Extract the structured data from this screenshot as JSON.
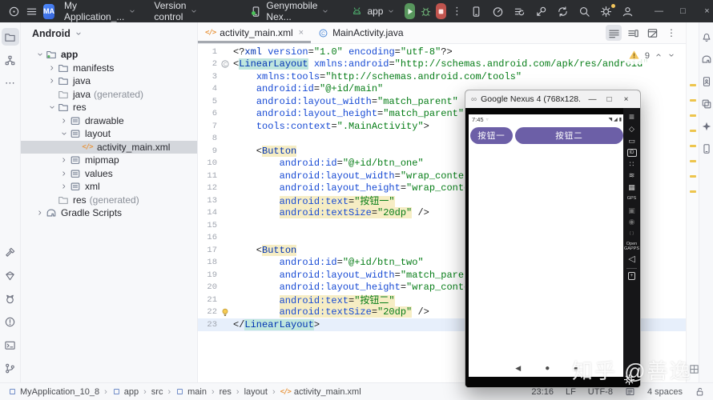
{
  "titlebar": {
    "project_badge": "MA",
    "project_name": "My Application_...",
    "vcs": "Version control",
    "device": "Genymobile Nex...",
    "run_config": "app",
    "win": [
      "—",
      "□",
      "×"
    ],
    "tool_icons": [
      {
        "name": "device-manager-icon",
        "icon": "devphone"
      },
      {
        "name": "profiler-icon",
        "icon": "speed"
      },
      {
        "name": "build-menu-icon",
        "icon": "buildlist"
      },
      {
        "name": "attach-debugger-icon",
        "icon": "attach"
      },
      {
        "name": "sync-project-icon",
        "icon": "sync"
      },
      {
        "name": "search-everywhere-icon",
        "icon": "search"
      },
      {
        "name": "settings-icon",
        "icon": "gear",
        "dot": true
      },
      {
        "name": "account-icon",
        "icon": "user"
      }
    ]
  },
  "tabs": [
    {
      "label": "activity_main.xml",
      "icon": "codetag",
      "active": true,
      "closable": true,
      "close_glyph": "×"
    },
    {
      "label": "MainActivity.java",
      "icon": "classc",
      "active": false
    }
  ],
  "project_panel": {
    "header": "Android",
    "tree": [
      {
        "label": "app",
        "icon": "folderapp",
        "chev": "open",
        "indent": 1,
        "bold": true
      },
      {
        "label": "manifests",
        "icon": "folder",
        "chev": "closed",
        "indent": 2
      },
      {
        "label": "java",
        "icon": "folder",
        "chev": "closed",
        "indent": 2
      },
      {
        "label": "java",
        "suffix": "(generated)",
        "icon": "foldergen",
        "indent": 2
      },
      {
        "label": "res",
        "icon": "folderres",
        "chev": "open",
        "indent": 2
      },
      {
        "label": "drawable",
        "icon": "resdir",
        "chev": "closed",
        "indent": 3
      },
      {
        "label": "layout",
        "icon": "resdir",
        "chev": "open",
        "indent": 3
      },
      {
        "label": "activity_main.xml",
        "icon": "codetag",
        "indent": 4,
        "selected": true
      },
      {
        "label": "mipmap",
        "icon": "resdir",
        "chev": "closed",
        "indent": 3
      },
      {
        "label": "values",
        "icon": "resdir",
        "chev": "closed",
        "indent": 3
      },
      {
        "label": "xml",
        "icon": "resdir",
        "chev": "closed",
        "indent": 3
      },
      {
        "label": "res",
        "suffix": "(generated)",
        "icon": "foldergen",
        "indent": 2
      },
      {
        "label": "Gradle Scripts",
        "icon": "elephant",
        "chev": "closed",
        "indent": 1
      }
    ]
  },
  "left_stripe": {
    "top": [
      {
        "name": "project-tool-icon",
        "icon": "folder",
        "sel": true
      },
      {
        "name": "structure-tool-icon",
        "icon": "structure"
      },
      {
        "name": "more-tools-icon",
        "glyph": "⋯"
      }
    ],
    "bottom": [
      {
        "name": "build-tool-icon",
        "icon": "hammer"
      },
      {
        "name": "app-quality-insights-icon",
        "icon": "gem"
      },
      {
        "name": "logcat-icon",
        "icon": "cat"
      },
      {
        "name": "problems-icon",
        "icon": "warnc"
      },
      {
        "name": "terminal-icon",
        "icon": "term"
      },
      {
        "name": "version-control-icon",
        "icon": "branch"
      }
    ]
  },
  "right_stripe": [
    {
      "name": "notifications-icon",
      "icon": "bell"
    },
    {
      "name": "gradle-icon",
      "icon": "elephant"
    },
    {
      "name": "device-manager-icon",
      "icon": "phoneuser"
    },
    {
      "name": "device-explorer-icon",
      "icon": "layers"
    },
    {
      "name": "gemini-icon",
      "icon": "sparkle"
    },
    {
      "name": "running-devices-icon",
      "icon": "phone"
    }
  ],
  "editor": {
    "warning_count": "9",
    "stripe_marks": [
      77,
      96,
      115,
      134,
      153,
      172,
      191,
      210
    ],
    "lines": [
      {
        "n": "1",
        "s": [
          [
            "p",
            "<?"
          ],
          [
            "t",
            "xml"
          ],
          [
            "p",
            " "
          ],
          [
            "a",
            "version"
          ],
          [
            "p",
            "="
          ],
          [
            "s",
            "\"1.0\""
          ],
          [
            "p",
            " "
          ],
          [
            "a",
            "encoding"
          ],
          [
            "p",
            "="
          ],
          [
            "s",
            "\"utf-8\""
          ],
          [
            "p",
            "?>"
          ]
        ]
      },
      {
        "n": "2",
        "g": "classg",
        "s": [
          [
            "p",
            "<"
          ],
          [
            "tm",
            "LinearLayout"
          ],
          [
            "p",
            " "
          ],
          [
            "a",
            "xmlns:android"
          ],
          [
            "p",
            "="
          ],
          [
            "s",
            "\"http://schemas.android.com/apk/res/android\""
          ]
        ]
      },
      {
        "n": "3",
        "s": [
          [
            "p",
            "    "
          ],
          [
            "a",
            "xmlns:tools"
          ],
          [
            "p",
            "="
          ],
          [
            "s",
            "\"http://schemas.android.com/tools\""
          ]
        ]
      },
      {
        "n": "4",
        "s": [
          [
            "p",
            "    "
          ],
          [
            "a",
            "android:id"
          ],
          [
            "p",
            "="
          ],
          [
            "s",
            "\"@+id/main\""
          ]
        ]
      },
      {
        "n": "5",
        "s": [
          [
            "p",
            "    "
          ],
          [
            "a",
            "android:layout_width"
          ],
          [
            "p",
            "="
          ],
          [
            "s",
            "\"match_parent\""
          ]
        ]
      },
      {
        "n": "6",
        "s": [
          [
            "p",
            "    "
          ],
          [
            "a",
            "android:layout_height"
          ],
          [
            "p",
            "="
          ],
          [
            "s",
            "\"match_parent\""
          ]
        ]
      },
      {
        "n": "7",
        "s": [
          [
            "p",
            "    "
          ],
          [
            "a",
            "tools:context"
          ],
          [
            "p",
            "="
          ],
          [
            "s",
            "\".MainActivity\""
          ],
          [
            "p",
            ">"
          ]
        ]
      },
      {
        "n": "8",
        "s": []
      },
      {
        "n": "9",
        "s": [
          [
            "p",
            "    <"
          ],
          [
            "wt",
            "Button"
          ]
        ]
      },
      {
        "n": "10",
        "s": [
          [
            "p",
            "        "
          ],
          [
            "a",
            "android:id"
          ],
          [
            "p",
            "="
          ],
          [
            "s",
            "\"@+id/btn_one\""
          ]
        ]
      },
      {
        "n": "11",
        "s": [
          [
            "p",
            "        "
          ],
          [
            "a",
            "android:layout_width"
          ],
          [
            "p",
            "="
          ],
          [
            "s",
            "\"wrap_content\""
          ]
        ]
      },
      {
        "n": "12",
        "s": [
          [
            "p",
            "        "
          ],
          [
            "a",
            "android:layout_height"
          ],
          [
            "p",
            "="
          ],
          [
            "s",
            "\"wrap_content\""
          ]
        ]
      },
      {
        "n": "13",
        "s": [
          [
            "p",
            "        "
          ],
          [
            "wa",
            "android:text"
          ],
          [
            "wp",
            "="
          ],
          [
            "ws",
            "\"按钮一\""
          ]
        ]
      },
      {
        "n": "14",
        "s": [
          [
            "p",
            "        "
          ],
          [
            "wa",
            "android:textSize"
          ],
          [
            "wp",
            "="
          ],
          [
            "ws",
            "\"20dp\""
          ],
          [
            "p",
            " />"
          ]
        ]
      },
      {
        "n": "15",
        "s": []
      },
      {
        "n": "16",
        "s": []
      },
      {
        "n": "17",
        "s": [
          [
            "p",
            "    <"
          ],
          [
            "wt",
            "Button"
          ]
        ]
      },
      {
        "n": "18",
        "s": [
          [
            "p",
            "        "
          ],
          [
            "a",
            "android:id"
          ],
          [
            "p",
            "="
          ],
          [
            "s",
            "\"@+id/btn_two\""
          ]
        ]
      },
      {
        "n": "19",
        "s": [
          [
            "p",
            "        "
          ],
          [
            "a",
            "android:layout_width"
          ],
          [
            "p",
            "="
          ],
          [
            "s",
            "\"match_parent\""
          ]
        ]
      },
      {
        "n": "20",
        "s": [
          [
            "p",
            "        "
          ],
          [
            "a",
            "android:layout_height"
          ],
          [
            "p",
            "="
          ],
          [
            "s",
            "\"wrap_content\""
          ]
        ]
      },
      {
        "n": "21",
        "s": [
          [
            "p",
            "        "
          ],
          [
            "wa",
            "android:text"
          ],
          [
            "wp",
            "="
          ],
          [
            "ws",
            "\"按钮二\""
          ]
        ]
      },
      {
        "n": "22",
        "g": "bulb",
        "s": [
          [
            "p",
            "        "
          ],
          [
            "wa",
            "android:textSize"
          ],
          [
            "wp",
            "="
          ],
          [
            "ws",
            "\"20dp\""
          ],
          [
            "p",
            " />"
          ]
        ]
      },
      {
        "n": "23",
        "caret": true,
        "s": [
          [
            "p",
            "</"
          ],
          [
            "tm",
            "LinearLayout"
          ],
          [
            "p",
            ">"
          ]
        ]
      }
    ]
  },
  "statusbar": {
    "breadcrumbs": [
      {
        "label": "MyApplication_10_8",
        "icon": "module"
      },
      {
        "label": "app",
        "icon": "module"
      },
      {
        "label": "src"
      },
      {
        "label": "main",
        "icon": "module"
      },
      {
        "label": "res"
      },
      {
        "label": "layout"
      },
      {
        "label": "activity_main.xml",
        "icon": "codetag"
      }
    ],
    "sep": "›",
    "right": [
      {
        "t": "23:16",
        "name": "caret-position"
      },
      {
        "t": "LF",
        "name": "line-ending"
      },
      {
        "t": "UTF-8",
        "name": "encoding"
      },
      {
        "icon": "indents",
        "name": "indent-config-icon"
      },
      {
        "t": "4 spaces",
        "name": "indent-size"
      },
      {
        "icon": "lockopen",
        "name": "write-access-icon"
      }
    ]
  },
  "emulator": {
    "title": "Google Nexus 4 (768x128...",
    "logo_glyph": "∞",
    "win": [
      "—",
      "□",
      "×"
    ],
    "time": "7:45",
    "status_dim": "▿",
    "status_icons": [
      "◥",
      "◢",
      "▮"
    ],
    "button_color": "#6c5fa7",
    "app_buttons": [
      "按钮一",
      "按钮二"
    ],
    "nav": [
      "◀",
      "●",
      "■"
    ],
    "toolbar": [
      {
        "name": "menu-icon",
        "g": "≡",
        "size": 12
      },
      {
        "name": "rotate-icon",
        "g": "◇"
      },
      {
        "name": "battery-icon",
        "g": "▭"
      },
      {
        "name": "identifiers-icon",
        "g": "ID",
        "box": true
      },
      {
        "name": "pixel-perfect-icon",
        "g": "∷"
      },
      {
        "name": "network-icon",
        "g": "≋"
      },
      {
        "name": "baseband-icon",
        "g": "▦"
      },
      {
        "name": "gps-icon",
        "g": "GPS",
        "txt": true
      },
      {
        "name": "screenshot-icon",
        "g": "▣",
        "dim": true
      },
      {
        "name": "camera-icon",
        "g": "◉",
        "dim": true
      },
      {
        "name": "widgets-icon",
        "g": "{ }",
        "txt": true,
        "dim": true
      },
      {
        "name": "open-gapps-button",
        "g": "Open GAPPS",
        "txt": true
      },
      {
        "name": "back-icon",
        "g": "◁",
        "size": 11
      },
      {
        "name": "divider",
        "div": true
      },
      {
        "name": "zoom-icon",
        "g": "+",
        "box": true
      }
    ]
  },
  "watermark": "知乎 @善逸"
}
